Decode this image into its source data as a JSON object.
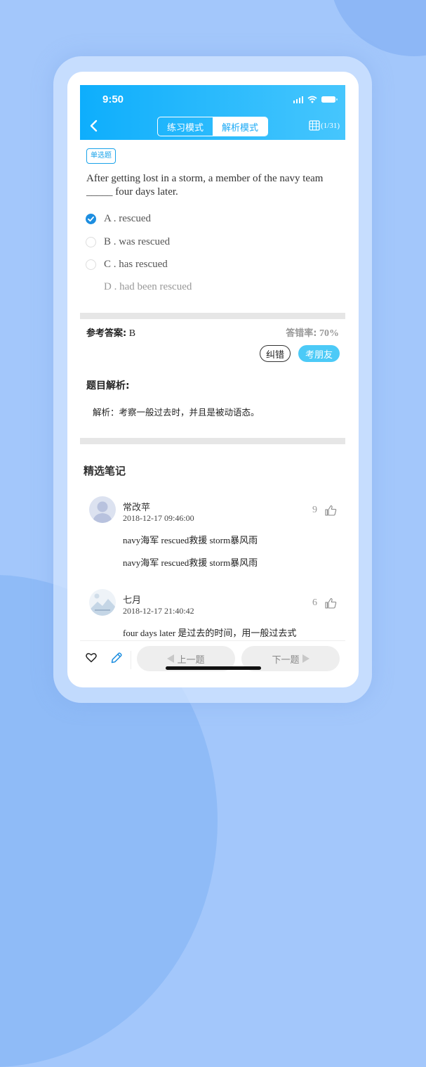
{
  "status_bar": {
    "time": "9:50"
  },
  "header": {
    "modes": [
      "练习模式",
      "解析模式"
    ],
    "active_mode": "解析模式",
    "progress": "(1/31)"
  },
  "question": {
    "type_badge": "单选题",
    "text": "After getting lost in a storm, a member of the navy team _____ four days later.",
    "options": [
      {
        "label": "A . rescued",
        "state": "checked"
      },
      {
        "label": "B . was rescued",
        "state": "unchecked"
      },
      {
        "label": "C . has rescued",
        "state": "unchecked"
      },
      {
        "label": "D . had been rescued",
        "state": "none"
      }
    ]
  },
  "answer": {
    "label": "参考答案:",
    "value": "B",
    "error_rate_label": "答错率:",
    "error_rate_value": "70%",
    "correct_button": "纠错",
    "friend_button": "考朋友"
  },
  "analysis": {
    "title": "题目解析:",
    "text": "解析：考察一般过去时，并且是被动语态。"
  },
  "notes": {
    "title": "精选笔记",
    "items": [
      {
        "user": "常改苹",
        "time": "2018-12-17 09:46:00",
        "likes": "9",
        "lines": [
          "navy海军 rescued救援 storm暴风雨",
          "navy海军 rescued救援 storm暴风雨"
        ]
      },
      {
        "user": "七月",
        "time": "2018-12-17 21:40:42",
        "likes": "6",
        "lines": [
          "four days later 是过去的时间，用一般过去式"
        ]
      }
    ]
  },
  "bottom_bar": {
    "prev_label": "上一题",
    "next_label": "下一题"
  },
  "colors": {
    "accent": "#1aa9f5",
    "friend_button": "#4ccaf7",
    "background": "#a3c7fb"
  }
}
